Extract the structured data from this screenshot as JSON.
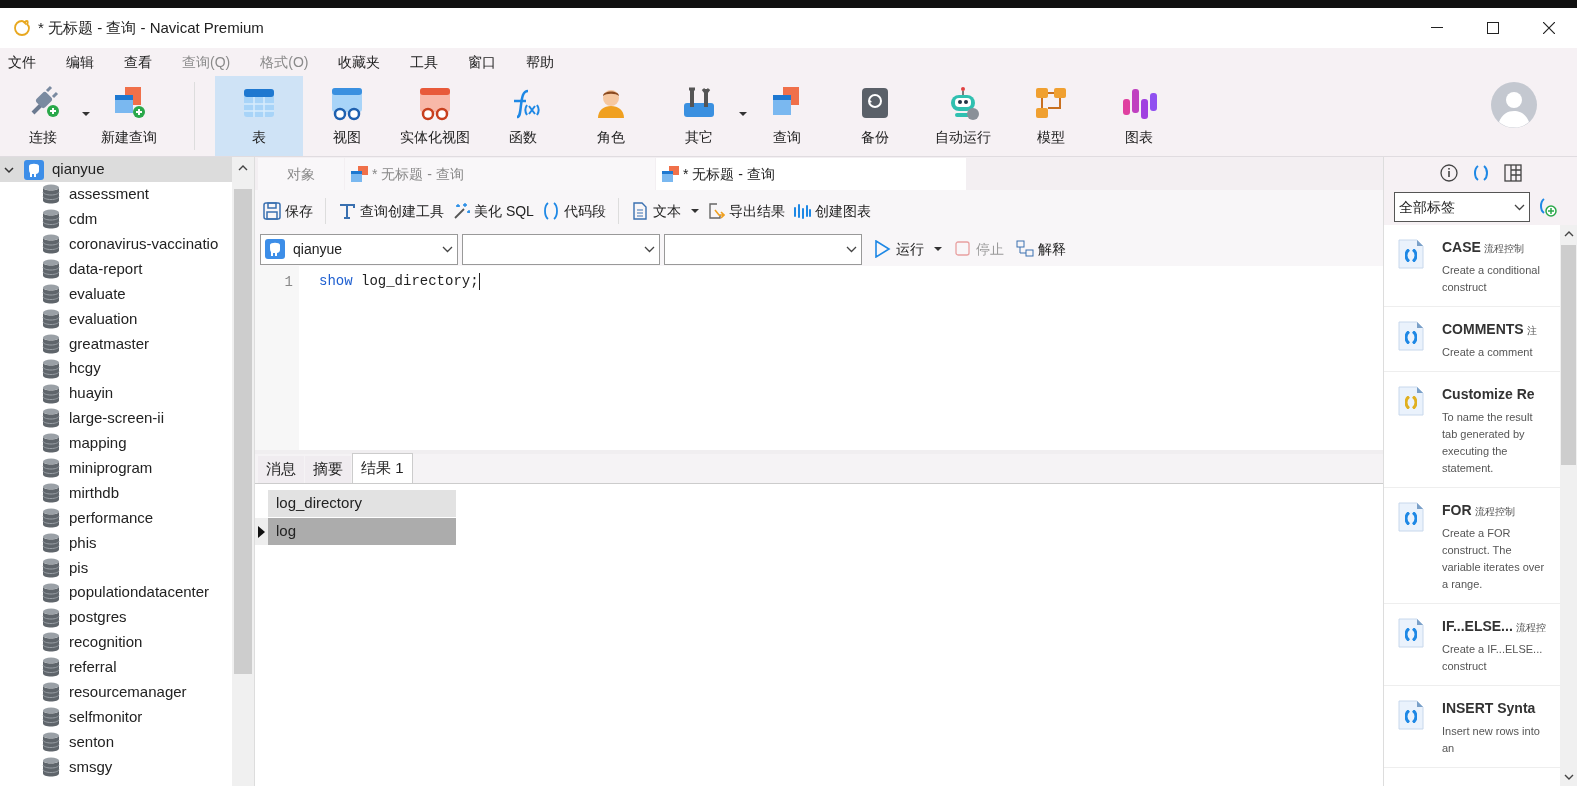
{
  "window": {
    "title": "* 无标题 - 查询 - Navicat Premium"
  },
  "menu": [
    {
      "label": "文件",
      "disabled": false
    },
    {
      "label": "编辑",
      "disabled": false
    },
    {
      "label": "查看",
      "disabled": false
    },
    {
      "label": "查询(Q)",
      "disabled": true
    },
    {
      "label": "格式(O)",
      "disabled": true
    },
    {
      "label": "收藏夹",
      "disabled": false
    },
    {
      "label": "工具",
      "disabled": false
    },
    {
      "label": "窗口",
      "disabled": false
    },
    {
      "label": "帮助",
      "disabled": false
    }
  ],
  "toolbar": [
    {
      "label": "连接",
      "selected": false,
      "dropdown": true
    },
    {
      "label": "新建查询",
      "selected": false,
      "dropdown": false
    },
    {
      "label": "表",
      "selected": true,
      "dropdown": false
    },
    {
      "label": "视图",
      "selected": false,
      "dropdown": false
    },
    {
      "label": "实体化视图",
      "selected": false,
      "dropdown": false
    },
    {
      "label": "函数",
      "selected": false,
      "dropdown": false
    },
    {
      "label": "角色",
      "selected": false,
      "dropdown": false
    },
    {
      "label": "其它",
      "selected": false,
      "dropdown": true
    },
    {
      "label": "查询",
      "selected": false,
      "dropdown": false
    },
    {
      "label": "备份",
      "selected": false,
      "dropdown": false
    },
    {
      "label": "自动运行",
      "selected": false,
      "dropdown": false
    },
    {
      "label": "模型",
      "selected": false,
      "dropdown": false
    },
    {
      "label": "图表",
      "selected": false,
      "dropdown": false
    }
  ],
  "sidebar": {
    "items": [
      {
        "label": "qianyue",
        "expanded": true,
        "selected": true,
        "children": [
          {
            "label": "assessment"
          },
          {
            "label": "cdm"
          },
          {
            "label": "coronavirus-vaccinatio"
          },
          {
            "label": "data-report"
          },
          {
            "label": "evaluate"
          },
          {
            "label": "evaluation"
          },
          {
            "label": "greatmaster"
          },
          {
            "label": "hcgy"
          },
          {
            "label": "huayin"
          },
          {
            "label": "large-screen-ii"
          },
          {
            "label": "mapping"
          },
          {
            "label": "miniprogram"
          },
          {
            "label": "mirthdb"
          },
          {
            "label": "performance"
          },
          {
            "label": "phis"
          },
          {
            "label": "pis"
          },
          {
            "label": "populationdatacenter"
          },
          {
            "label": "postgres"
          },
          {
            "label": "recognition"
          },
          {
            "label": "referral"
          },
          {
            "label": "resourcemanager"
          },
          {
            "label": "selfmonitor"
          },
          {
            "label": "senton"
          },
          {
            "label": "smsgy"
          }
        ]
      }
    ]
  },
  "editor_tabs": [
    {
      "label": "对象",
      "kind": "objects",
      "selected": false
    },
    {
      "label": "* 无标题 - 查询",
      "kind": "query",
      "selected": false
    },
    {
      "label": "* 无标题 - 查询",
      "kind": "query",
      "selected": true
    }
  ],
  "query_toolbar": [
    {
      "label": "保存",
      "dropdown": false
    },
    {
      "label": "查询创建工具",
      "dropdown": false
    },
    {
      "label": "美化 SQL",
      "dropdown": false
    },
    {
      "label": "代码段",
      "dropdown": false
    },
    {
      "label": "文本",
      "dropdown": true
    },
    {
      "label": "导出结果",
      "dropdown": false
    },
    {
      "label": "创建图表",
      "dropdown": false
    }
  ],
  "selectors": {
    "connection": "qianyue"
  },
  "run_controls": [
    {
      "label": "运行",
      "disabled": false,
      "dropdown": true
    },
    {
      "label": "停止",
      "disabled": true,
      "dropdown": false
    },
    {
      "label": "解释",
      "disabled": false,
      "dropdown": false
    }
  ],
  "editor": {
    "lines": [
      {
        "number": "1",
        "code": "show log_directory;"
      }
    ]
  },
  "result_tabs": [
    {
      "label": "消息",
      "selected": false
    },
    {
      "label": "摘要",
      "selected": false
    },
    {
      "label": "结果 1",
      "selected": true
    }
  ],
  "result_grid": {
    "columns": [
      "log_directory"
    ],
    "rows": [
      {
        "cells": [
          "log"
        ],
        "selected": true
      }
    ]
  },
  "snippets_panel": {
    "filter": "全部标签",
    "items": [
      {
        "title": "CASE",
        "tag": "流程控制",
        "description": "Create a conditional construct",
        "color": "#1e88e5"
      },
      {
        "title": "COMMENTS",
        "tag": "注",
        "description": "Create a comment",
        "color": "#1e88e5"
      },
      {
        "title": "Customize Re",
        "description": "To name the result tab generated by executing the statement.",
        "color": "#e0b020"
      },
      {
        "title": "FOR",
        "tag": "流程控制",
        "description": "Create a FOR construct. The variable iterates over a range.",
        "color": "#1e88e5"
      },
      {
        "title": "IF...ELSE...",
        "tag": "流程控",
        "description": "Create a IF...ELSE... construct",
        "color": "#1e88e5"
      },
      {
        "title": "INSERT Synta",
        "description": "Insert new rows into an",
        "color": "#1e88e5"
      }
    ]
  }
}
